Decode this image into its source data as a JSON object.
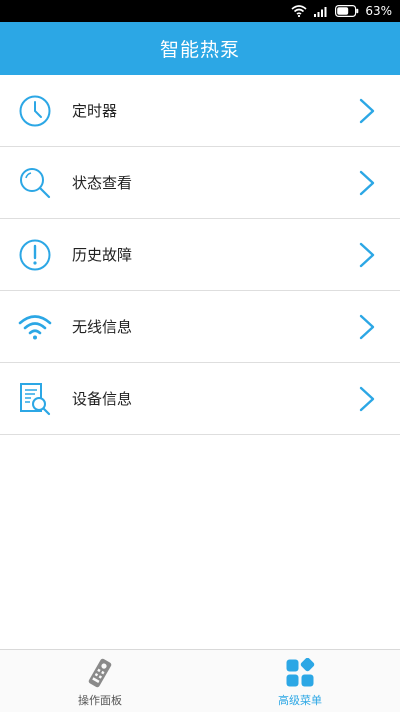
{
  "status_bar": {
    "battery": "63%"
  },
  "header": {
    "title": "智能热泵"
  },
  "menu": {
    "items": [
      {
        "label": "定时器",
        "icon": "clock-icon"
      },
      {
        "label": "状态查看",
        "icon": "search-icon"
      },
      {
        "label": "历史故障",
        "icon": "alert-icon"
      },
      {
        "label": "无线信息",
        "icon": "wifi-icon"
      },
      {
        "label": "设备信息",
        "icon": "document-search-icon"
      }
    ]
  },
  "bottom_nav": {
    "tabs": [
      {
        "label": "操作面板",
        "icon": "remote-control-icon",
        "active": false
      },
      {
        "label": "高级菜单",
        "icon": "grid-menu-icon",
        "active": true
      }
    ]
  },
  "colors": {
    "accent": "#2ca7e5",
    "inactive_icon": "#8a8a8a"
  }
}
